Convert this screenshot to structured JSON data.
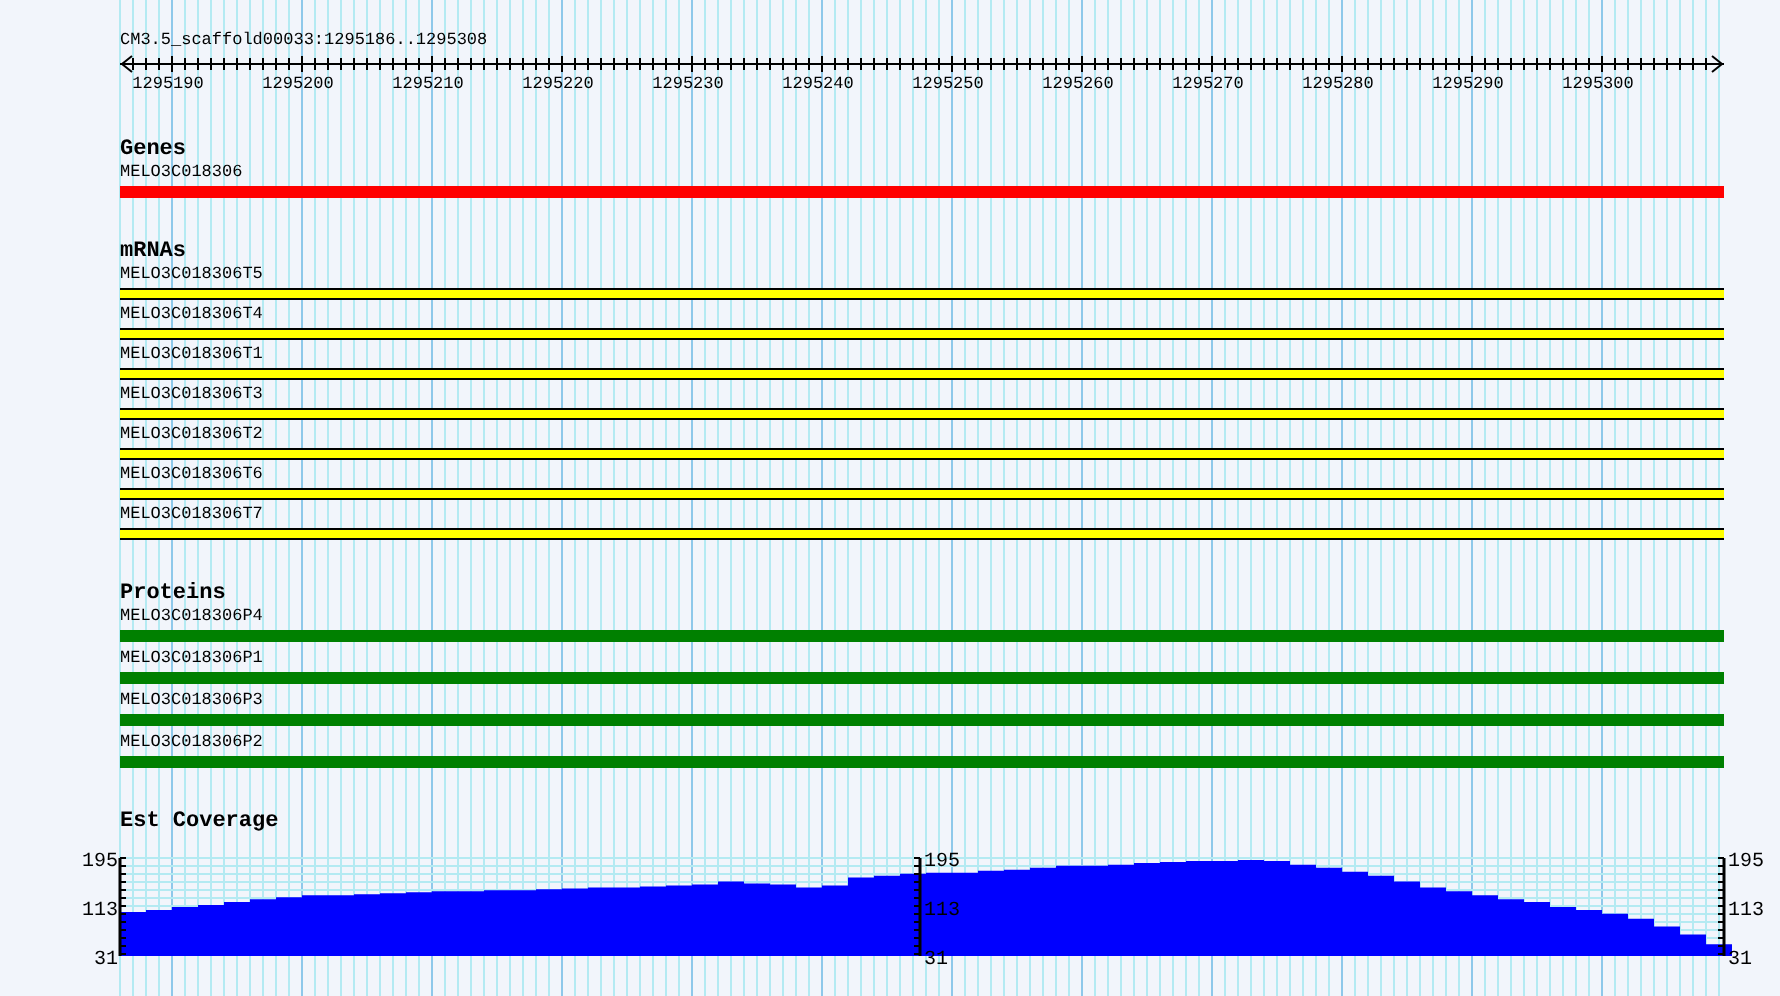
{
  "ruler": {
    "title": "CM3.5_scaffold00033:1295186..1295308",
    "labels": [
      "1295190",
      "1295200",
      "1295210",
      "1295220",
      "1295230",
      "1295240",
      "1295250",
      "1295260",
      "1295270",
      "1295280",
      "1295290",
      "1295300"
    ]
  },
  "tracks": [
    {
      "kind": "gene",
      "title": "Genes",
      "features": [
        "MELO3C018306"
      ]
    },
    {
      "kind": "mrna",
      "title": "mRNAs",
      "features": [
        "MELO3C018306T5",
        "MELO3C018306T4",
        "MELO3C018306T1",
        "MELO3C018306T3",
        "MELO3C018306T2",
        "MELO3C018306T6",
        "MELO3C018306T7"
      ]
    },
    {
      "kind": "protein",
      "title": "Proteins",
      "features": [
        "MELO3C018306P4",
        "MELO3C018306P1",
        "MELO3C018306P3",
        "MELO3C018306P2"
      ]
    },
    {
      "kind": "coverage",
      "title": "Est Coverage",
      "axes": [
        {
          "ticks": [
            "195",
            "113",
            "31"
          ]
        },
        {
          "ticks": [
            "195",
            "113",
            "31"
          ]
        },
        {
          "ticks": [
            "195",
            "113",
            "31"
          ]
        }
      ]
    }
  ]
}
